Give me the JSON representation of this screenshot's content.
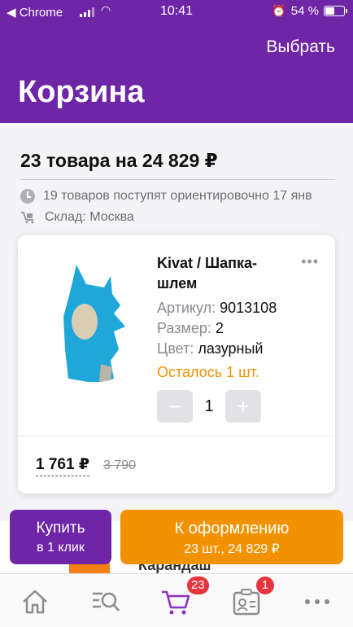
{
  "status_bar": {
    "back_app": "◀ Chrome",
    "time": "10:41",
    "battery": "54 %",
    "battery_level": 0.54
  },
  "header": {
    "action": "Выбрать",
    "title": "Корзина"
  },
  "summary": {
    "total": "23 товара на 24 829 ₽",
    "delivery_note": "19 товаров поступят ориентировочно 17 янв",
    "warehouse": "Склад: Москва"
  },
  "item": {
    "name": "Kivat / Шапка-шлем",
    "article_label": "Артикул:",
    "article_value": "9013108",
    "size_label": "Размер:",
    "size_value": "2",
    "color_label": "Цвет:",
    "color_value": "лазурный",
    "stock_note": "Осталось 1 шт.",
    "quantity": "1",
    "minus": "−",
    "plus": "+",
    "price": "1 761 ₽",
    "old_price": "3 790",
    "more": "•••"
  },
  "peek": {
    "text": "Карандаш"
  },
  "buttons": {
    "buy_line1": "Купить",
    "buy_line2": "в 1 клик",
    "checkout_line1": "К оформлению",
    "checkout_line2": "23 шт., 24 829 ₽"
  },
  "tabbar": {
    "cart_badge": "23",
    "profile_badge": "1",
    "tabs": [
      "home-icon",
      "search-icon",
      "cart-icon",
      "profile-icon",
      "more-icon"
    ]
  },
  "colors": {
    "brand": "#6e25a6",
    "accent": "#f39200",
    "badge": "#e8343e",
    "product": "#1fa7d9"
  }
}
